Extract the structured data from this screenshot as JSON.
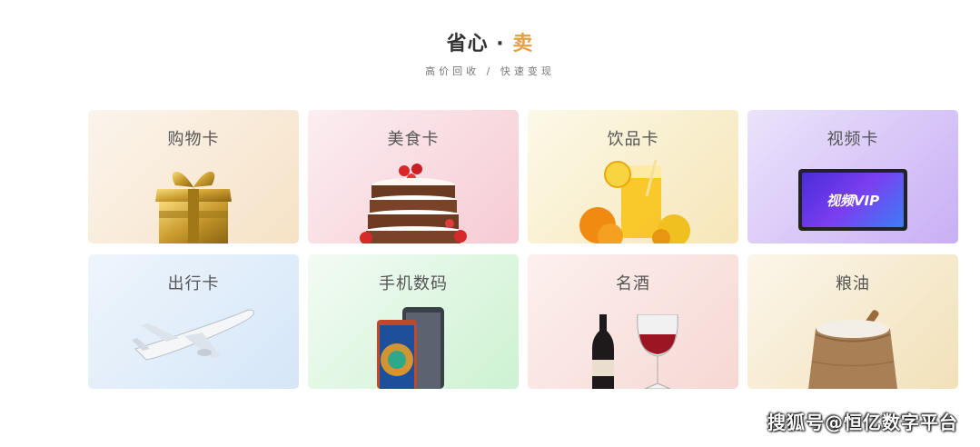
{
  "header": {
    "title_main": "省心 · ",
    "title_accent": "卖",
    "subtitle": "高价回收 / 快速变现"
  },
  "cards": [
    {
      "label": "购物卡",
      "icon": "gift-box-icon"
    },
    {
      "label": "美食卡",
      "icon": "cake-icon"
    },
    {
      "label": "饮品卡",
      "icon": "juice-icon"
    },
    {
      "label": "视频卡",
      "icon": "video-vip-screen-icon",
      "screen_text": "视频VIP"
    },
    {
      "label": "出行卡",
      "icon": "airplane-icon"
    },
    {
      "label": "手机数码",
      "icon": "smartphone-icon"
    },
    {
      "label": "名酒",
      "icon": "wine-icon"
    },
    {
      "label": "粮油",
      "icon": "rice-sack-icon"
    }
  ],
  "watermark": "搜狐号@恒亿数字平台",
  "colors": {
    "accent": "#e3a046",
    "title": "#333333",
    "subtitle": "#777777"
  }
}
